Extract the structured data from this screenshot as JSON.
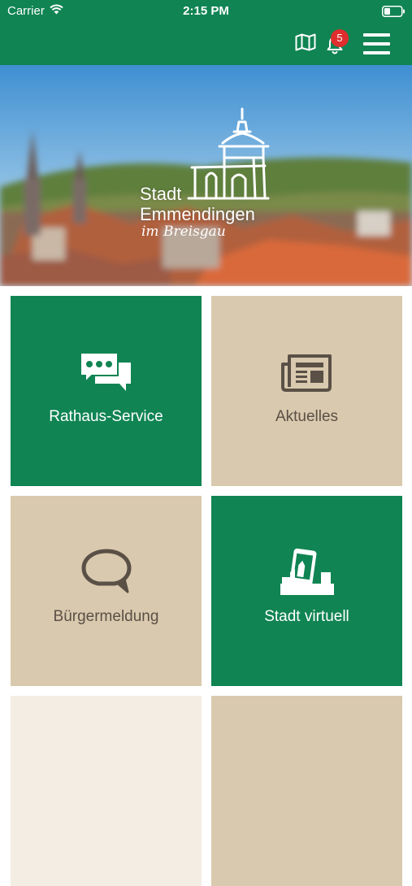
{
  "status_bar": {
    "carrier": "Carrier",
    "time": "2:15 PM"
  },
  "nav": {
    "notification_count": "5",
    "icons": [
      "map-icon",
      "bell-icon",
      "hamburger-menu-icon"
    ]
  },
  "hero": {
    "logo_line1": "Stadt",
    "logo_line2": "Emmendingen",
    "logo_line3": "im Breisgau"
  },
  "tiles": [
    {
      "label": "Rathaus-Service",
      "icon": "chat-bubbles-icon",
      "color": "#108453"
    },
    {
      "label": "Aktuelles",
      "icon": "newspaper-icon",
      "color": "#d9c9ae"
    },
    {
      "label": "Bürgermeldung",
      "icon": "speech-bubble-icon",
      "color": "#d9c9ae"
    },
    {
      "label": "Stadt virtuell",
      "icon": "virtual-city-icon",
      "color": "#108453"
    }
  ],
  "colors": {
    "brand_green": "#108453",
    "beige": "#d9c9ae",
    "light_beige": "#f3ede4",
    "badge_red": "#e02d2d",
    "beige_text": "#5a5046"
  }
}
